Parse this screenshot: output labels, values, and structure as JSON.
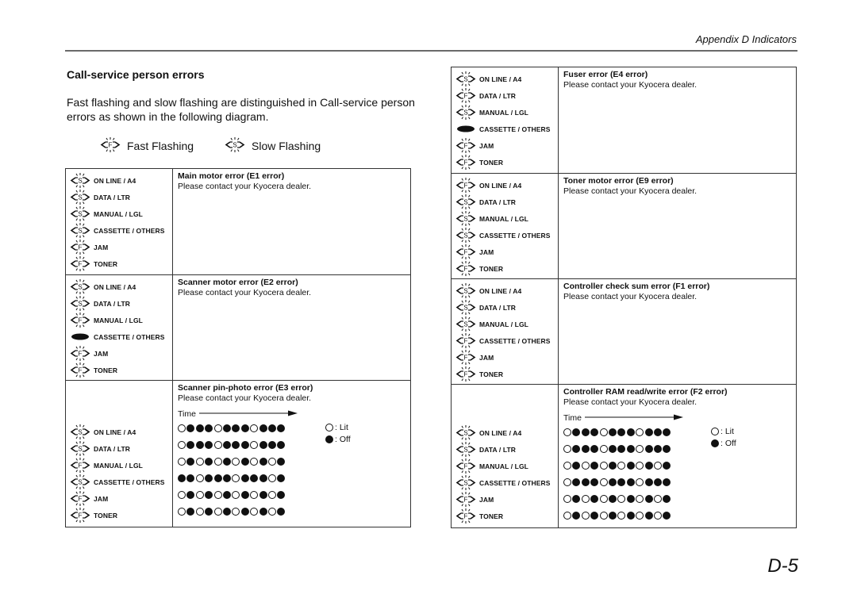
{
  "header": {
    "title": "Appendix D  Indicators"
  },
  "section": {
    "title": "Call-service person errors",
    "intro": "Fast flashing and slow flashing are distinguished in Call-service person errors as shown in the following diagram."
  },
  "legend": {
    "fast": {
      "icon": "fast-flash-icon",
      "letter": "F",
      "label": "Fast Flashing"
    },
    "slow": {
      "icon": "slow-flash-icon",
      "letter": "S",
      "label": "Slow Flashing"
    }
  },
  "lamp_labels": [
    "ON LINE / A4",
    "DATA / LTR",
    "MANUAL / LGL",
    "CASSETTE / OTHERS",
    "JAM",
    "TONER"
  ],
  "dot_legend": {
    "lit": ": Lit",
    "off": ": Off"
  },
  "time_label": "Time",
  "contact": "Please contact your Kyocera dealer.",
  "left_errors": [
    {
      "title": "Main motor error (E1 error)",
      "lamps": [
        "S",
        "S",
        "S",
        "S",
        "F",
        "F"
      ]
    },
    {
      "title": "Scanner motor error (E2 error)",
      "lamps": [
        "S",
        "S",
        "F",
        "ON",
        "F",
        "F"
      ]
    },
    {
      "title": "Scanner pin-photo error (E3 error)",
      "lamps": [
        "S",
        "S",
        "F",
        "S",
        "F",
        "F"
      ],
      "timing": [
        "○●●●○●●●○●●●",
        "○●●●○●●●○●●●",
        "○●○●○●○●○●○●",
        "●●○●●●○●●●○●",
        "○●○●○●○●○●○●",
        "○●○●○●○●○●○●"
      ]
    }
  ],
  "right_errors": [
    {
      "title": "Fuser error (E4 error)",
      "lamps": [
        "S",
        "F",
        "S",
        "ON",
        "F",
        "F"
      ]
    },
    {
      "title": "Toner motor error (E9 error)",
      "lamps": [
        "F",
        "S",
        "S",
        "S",
        "F",
        "F"
      ]
    },
    {
      "title": "Controller check sum error (F1 error)",
      "lamps": [
        "S",
        "S",
        "S",
        "F",
        "F",
        "F"
      ]
    },
    {
      "title": "Controller RAM read/write error (F2 error)",
      "lamps": [
        "S",
        "S",
        "F",
        "S",
        "F",
        "F"
      ],
      "timing": [
        "○●●●○●●●○●●●",
        "○●●●○●●●○●●●",
        "○●○●○●○●○●○●",
        "○●●●○●●●○●●●",
        "○●○●○●○●○●○●",
        "○●○●○●○●○●○●"
      ]
    }
  ],
  "page_number": "D-5"
}
